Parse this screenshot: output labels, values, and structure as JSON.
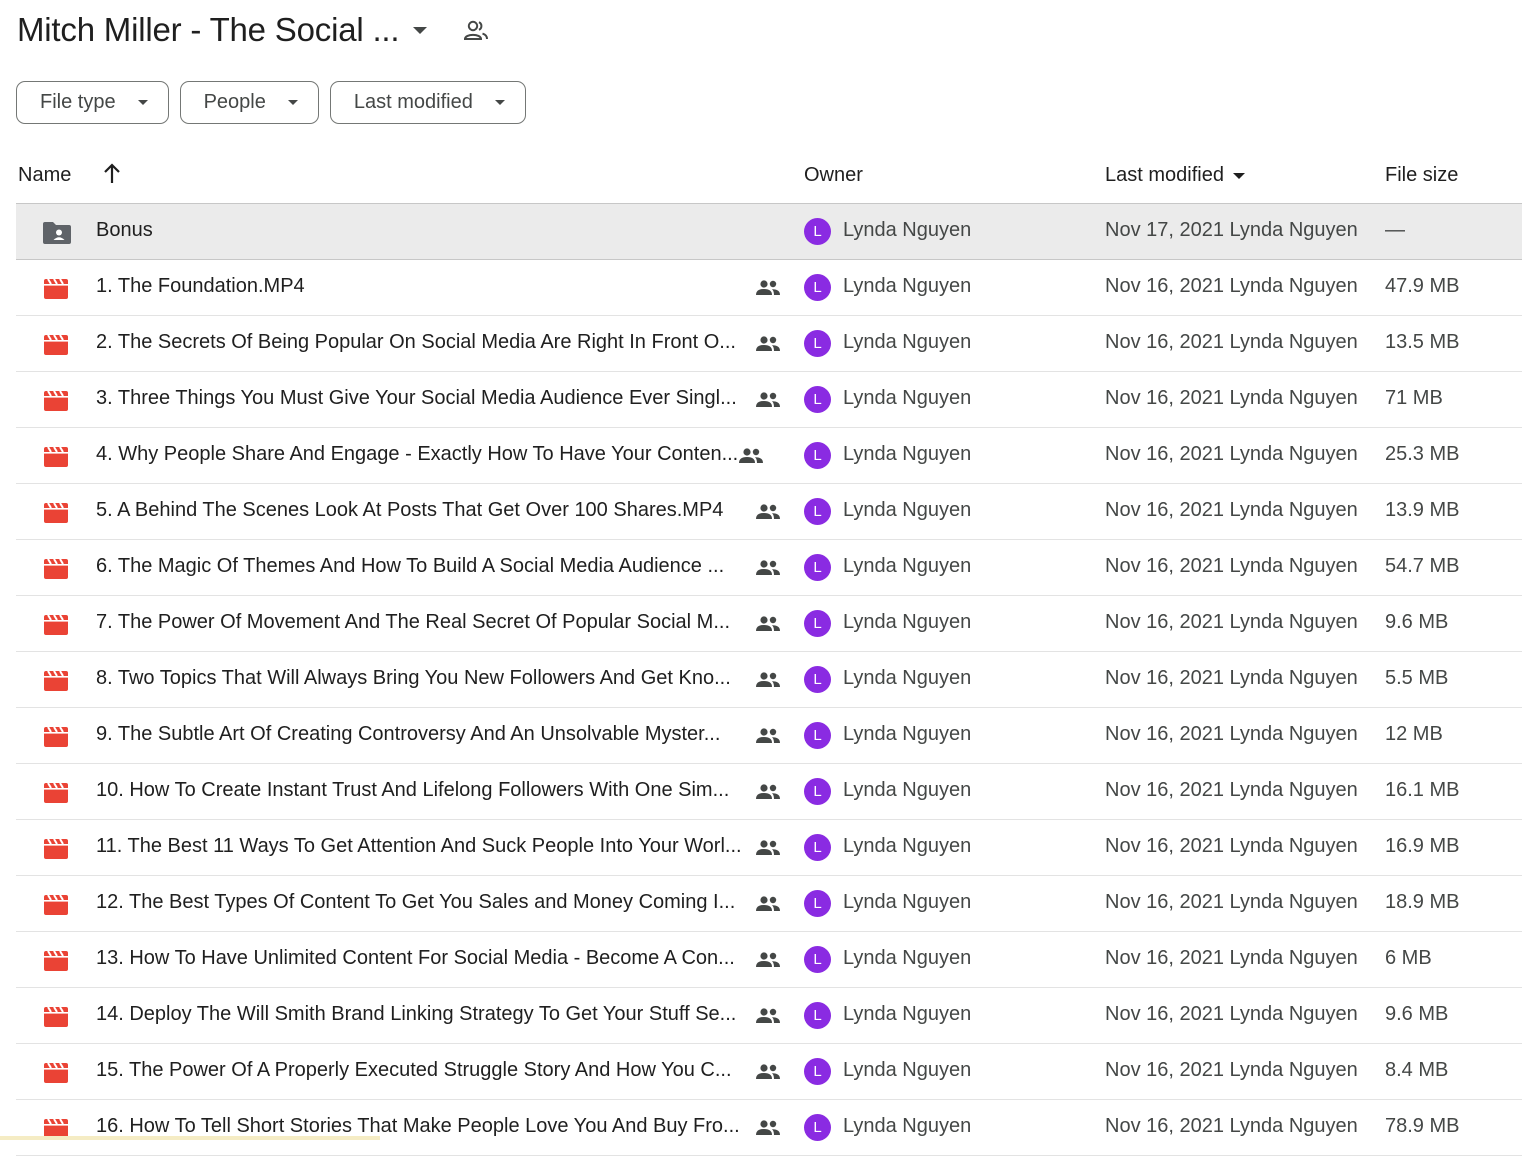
{
  "folder": {
    "title": "Mitch Miller - The Social ...",
    "caret_icon": "arrow-drop-down-icon",
    "share_icon": "people-icon"
  },
  "filters": [
    {
      "label": "File type"
    },
    {
      "label": "People"
    },
    {
      "label": "Last modified"
    }
  ],
  "columns": {
    "name": "Name",
    "owner": "Owner",
    "last_modified": "Last modified",
    "file_size": "File size"
  },
  "colors": {
    "video_icon": "#ea4335",
    "folder_icon": "#5f6368",
    "avatar": "#8a2be2",
    "selected_row": "#ebebeb"
  },
  "rows": [
    {
      "type": "folder",
      "name": "Bonus",
      "shared": false,
      "owner_initial": "L",
      "owner": "Lynda Nguyen",
      "modified": "Nov 17, 2021 Lynda Nguyen",
      "size": "—"
    },
    {
      "type": "video",
      "name": "1. The Foundation.MP4",
      "shared": true,
      "owner_initial": "L",
      "owner": "Lynda Nguyen",
      "modified": "Nov 16, 2021 Lynda Nguyen",
      "size": "47.9 MB"
    },
    {
      "type": "video",
      "name": "2. The Secrets Of Being Popular On Social Media Are Right In Front O...",
      "shared": true,
      "owner_initial": "L",
      "owner": "Lynda Nguyen",
      "modified": "Nov 16, 2021 Lynda Nguyen",
      "size": "13.5 MB"
    },
    {
      "type": "video",
      "name": "3. Three Things You Must Give Your Social Media Audience Ever Singl...",
      "shared": true,
      "owner_initial": "L",
      "owner": "Lynda Nguyen",
      "modified": "Nov 16, 2021 Lynda Nguyen",
      "size": "71 MB"
    },
    {
      "type": "video",
      "name": "4. Why People Share And Engage - Exactly How To Have Your Conten...",
      "shared": true,
      "owner_initial": "L",
      "owner": "Lynda Nguyen",
      "modified": "Nov 16, 2021 Lynda Nguyen",
      "size": "25.3 MB"
    },
    {
      "type": "video",
      "name": "5. A Behind The Scenes Look At Posts That Get Over 100 Shares.MP4",
      "shared": true,
      "owner_initial": "L",
      "owner": "Lynda Nguyen",
      "modified": "Nov 16, 2021 Lynda Nguyen",
      "size": "13.9 MB"
    },
    {
      "type": "video",
      "name": "6. The Magic Of Themes And How To Build A Social Media Audience ...",
      "shared": true,
      "owner_initial": "L",
      "owner": "Lynda Nguyen",
      "modified": "Nov 16, 2021 Lynda Nguyen",
      "size": "54.7 MB"
    },
    {
      "type": "video",
      "name": "7. The Power Of Movement And The Real Secret Of Popular Social M...",
      "shared": true,
      "owner_initial": "L",
      "owner": "Lynda Nguyen",
      "modified": "Nov 16, 2021 Lynda Nguyen",
      "size": "9.6 MB"
    },
    {
      "type": "video",
      "name": "8. Two Topics That Will Always Bring You New Followers And Get Kno...",
      "shared": true,
      "owner_initial": "L",
      "owner": "Lynda Nguyen",
      "modified": "Nov 16, 2021 Lynda Nguyen",
      "size": "5.5 MB"
    },
    {
      "type": "video",
      "name": "9. The Subtle Art Of Creating Controversy And An Unsolvable Myster...",
      "shared": true,
      "owner_initial": "L",
      "owner": "Lynda Nguyen",
      "modified": "Nov 16, 2021 Lynda Nguyen",
      "size": "12 MB"
    },
    {
      "type": "video",
      "name": "10. How To Create Instant Trust And Lifelong Followers With One Sim...",
      "shared": true,
      "owner_initial": "L",
      "owner": "Lynda Nguyen",
      "modified": "Nov 16, 2021 Lynda Nguyen",
      "size": "16.1 MB"
    },
    {
      "type": "video",
      "name": "11. The Best 11 Ways To Get Attention And Suck People Into Your Worl...",
      "shared": true,
      "owner_initial": "L",
      "owner": "Lynda Nguyen",
      "modified": "Nov 16, 2021 Lynda Nguyen",
      "size": "16.9 MB"
    },
    {
      "type": "video",
      "name": "12. The Best Types Of Content To Get You Sales and Money Coming I...",
      "shared": true,
      "owner_initial": "L",
      "owner": "Lynda Nguyen",
      "modified": "Nov 16, 2021 Lynda Nguyen",
      "size": "18.9 MB"
    },
    {
      "type": "video",
      "name": "13. How To Have Unlimited Content For Social Media - Become A Con...",
      "shared": true,
      "owner_initial": "L",
      "owner": "Lynda Nguyen",
      "modified": "Nov 16, 2021 Lynda Nguyen",
      "size": "6 MB"
    },
    {
      "type": "video",
      "name": "14. Deploy The Will Smith Brand Linking Strategy To Get Your Stuff Se...",
      "shared": true,
      "owner_initial": "L",
      "owner": "Lynda Nguyen",
      "modified": "Nov 16, 2021 Lynda Nguyen",
      "size": "9.6 MB"
    },
    {
      "type": "video",
      "name": "15. The Power Of A Properly Executed Struggle Story And How You C...",
      "shared": true,
      "owner_initial": "L",
      "owner": "Lynda Nguyen",
      "modified": "Nov 16, 2021 Lynda Nguyen",
      "size": "8.4 MB"
    },
    {
      "type": "video",
      "name": "16. How To Tell Short Stories That Make People Love You And Buy Fro...",
      "shared": true,
      "owner_initial": "L",
      "owner": "Lynda Nguyen",
      "modified": "Nov 16, 2021 Lynda Nguyen",
      "size": "78.9 MB"
    }
  ]
}
